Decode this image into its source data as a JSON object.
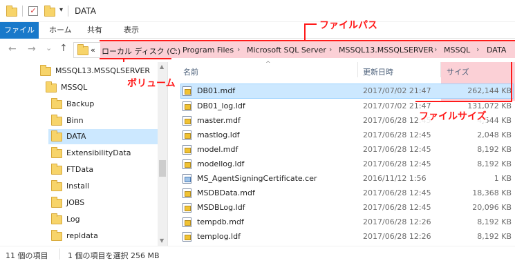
{
  "window": {
    "title": "DATA"
  },
  "ribbon": {
    "tabs": [
      "ファイル",
      "ホーム",
      "共有",
      "表示"
    ]
  },
  "nav": {
    "back": "←",
    "forward": "→",
    "recent": "⌄",
    "up": "↑"
  },
  "address": {
    "overflow": "«",
    "crumbs": [
      "ローカル ディスク (C:)",
      "Program Files",
      "Microsoft SQL Server",
      "MSSQL13.MSSQLSERVER",
      "MSSQL",
      "DATA"
    ],
    "separator": "›"
  },
  "sidebar": {
    "items": [
      {
        "label": "MSSQL13.MSSQLSERVER"
      },
      {
        "label": "MSSQL"
      },
      {
        "label": "Backup"
      },
      {
        "label": "Binn"
      },
      {
        "label": "DATA",
        "selected": true
      },
      {
        "label": "ExtensibilityData"
      },
      {
        "label": "FTData"
      },
      {
        "label": "Install"
      },
      {
        "label": "JOBS"
      },
      {
        "label": "Log"
      },
      {
        "label": "repldata"
      }
    ]
  },
  "columns": {
    "name": "名前",
    "date": "更新日時",
    "size": "サイズ"
  },
  "files": [
    {
      "name": "DB01.mdf",
      "date": "2017/07/02 21:47",
      "size": "262,144 KB",
      "icon": "database-file-icon",
      "selected": true
    },
    {
      "name": "DB01_log.ldf",
      "date": "2017/07/02 21:47",
      "size": "131,072 KB",
      "icon": "database-file-icon"
    },
    {
      "name": "master.mdf",
      "date": "2017/06/28 12:45",
      "size": "4,544 KB",
      "icon": "database-file-icon"
    },
    {
      "name": "mastlog.ldf",
      "date": "2017/06/28 12:45",
      "size": "2,048 KB",
      "icon": "database-file-icon"
    },
    {
      "name": "model.mdf",
      "date": "2017/06/28 12:45",
      "size": "8,192 KB",
      "icon": "database-file-icon"
    },
    {
      "name": "modellog.ldf",
      "date": "2017/06/28 12:45",
      "size": "8,192 KB",
      "icon": "database-file-icon"
    },
    {
      "name": "MS_AgentSigningCertificate.cer",
      "date": "2016/11/12 1:56",
      "size": "1 KB",
      "icon": "certificate-file-icon"
    },
    {
      "name": "MSDBData.mdf",
      "date": "2017/06/28 12:45",
      "size": "18,368 KB",
      "icon": "database-file-icon"
    },
    {
      "name": "MSDBLog.ldf",
      "date": "2017/06/28 12:45",
      "size": "20,096 KB",
      "icon": "database-file-icon"
    },
    {
      "name": "tempdb.mdf",
      "date": "2017/06/28 12:26",
      "size": "8,192 KB",
      "icon": "database-file-icon"
    },
    {
      "name": "templog.ldf",
      "date": "2017/06/28 12:26",
      "size": "8,192 KB",
      "icon": "database-file-icon"
    }
  ],
  "status": {
    "count": "11 個の項目",
    "selection": "1 個の項目を選択 256 MB"
  },
  "annotations": {
    "filepath": "ファイルパス",
    "volume": "ボリューム",
    "filesize": "ファイルサイズ"
  },
  "colors": {
    "annotation": "#ff1a1a",
    "highlight": "#fbd0d6",
    "selection": "#cce8ff",
    "file_tab": "#1979ca"
  }
}
